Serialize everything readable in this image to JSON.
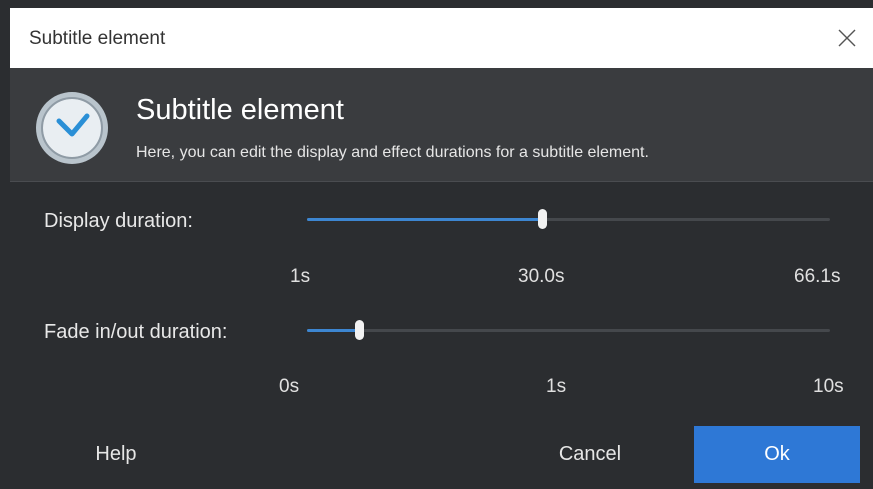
{
  "window": {
    "title": "Subtitle element"
  },
  "header": {
    "title": "Subtitle element",
    "subtitle": "Here, you can edit the display and effect durations for a subtitle element."
  },
  "display": {
    "label": "Display duration:",
    "min_label": "1s",
    "value_label": "30.0s",
    "max_label": "66.1s",
    "fraction": 0.45
  },
  "fade": {
    "label": "Fade in/out duration:",
    "min_label": "0s",
    "value_label": "1s",
    "max_label": "10s",
    "fraction": 0.1
  },
  "buttons": {
    "help": "Help",
    "cancel": "Cancel",
    "ok": "Ok"
  },
  "colors": {
    "accent": "#2e78d6",
    "slider_fill": "#3d86d1",
    "background": "#2b2d30",
    "header": "#3a3c3f"
  },
  "icons": {
    "header_icon": "clock-icon",
    "close_icon": "close-icon"
  }
}
